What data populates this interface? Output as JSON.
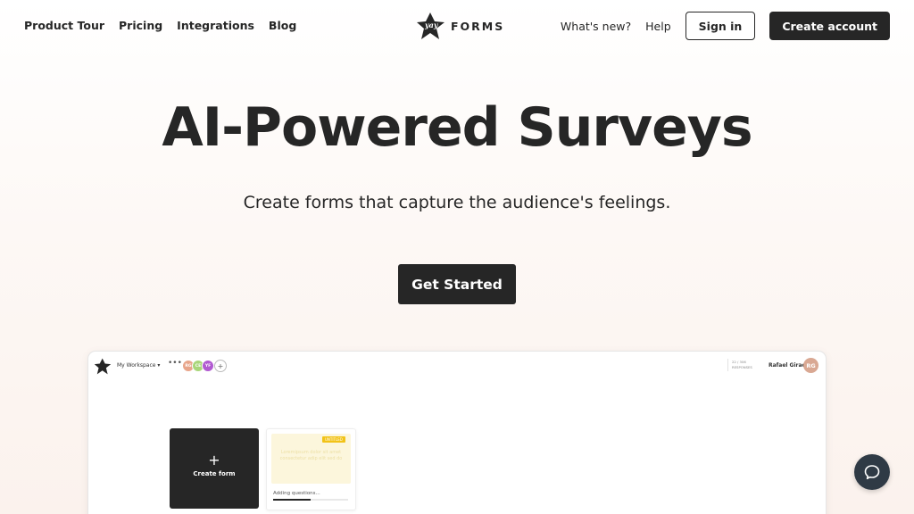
{
  "header": {
    "nav_left": [
      "Product Tour",
      "Pricing",
      "Integrations",
      "Blog"
    ],
    "logo_text": "FORMS",
    "whats_new": "What's new?",
    "help": "Help",
    "sign_in": "Sign in",
    "create_account": "Create account"
  },
  "hero": {
    "title": "AI-Powered Surveys",
    "subtitle": "Create forms that capture the audience's feelings.",
    "cta": "Get Started"
  },
  "preview": {
    "workspace": "My Workspace",
    "more": "•••",
    "avatars": [
      {
        "initials": "RG",
        "color": "#e8a58a"
      },
      {
        "initials": "CE",
        "color": "#a9d67a"
      },
      {
        "initials": "YF",
        "color": "#b15ad1"
      }
    ],
    "add_member": "+",
    "responses_count": "22 / 306",
    "responses_label": "RESPONSES",
    "user_name": "Rafael Girao",
    "user_initials": "RG",
    "create_form": "Create form",
    "create_plus": "+",
    "card": {
      "badge": "UNTITLED",
      "text": "Loremipsum dolor sit amet consectetur adip elit sed do",
      "status": "Adding questions...",
      "progress": 0.5
    }
  },
  "colors": {
    "primary": "#262626",
    "chat": "#2f3a45",
    "badge": "#f2c318"
  }
}
